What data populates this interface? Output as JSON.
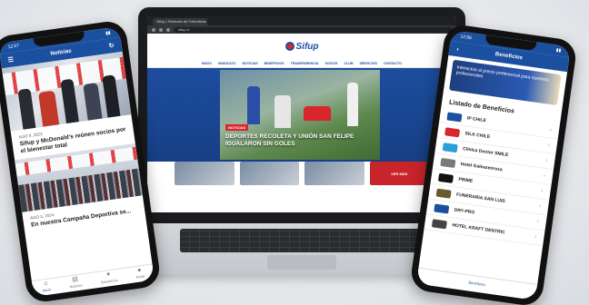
{
  "laptop": {
    "browser": {
      "tab_title": "Sifup | Sindicato de Futbolistas",
      "url": "sifup.cl"
    },
    "site": {
      "logo_text": "Sifup",
      "nav": [
        "INICIO",
        "SINDICATO",
        "NOTICIAS",
        "BENEFICIOS",
        "TRANSPARENCIA",
        "SOCIOS",
        "CLUB",
        "SERVICIOS",
        "CONTACTO"
      ],
      "hero": {
        "tag": "NOTICIAS",
        "title": "DEPORTES RECOLETA Y UNIÓN SAN FELIPE IGUALARON SIN GOLES"
      },
      "thumb_button": "VER MÁS"
    }
  },
  "phone_left": {
    "time": "12:57",
    "title": "Noticias",
    "news": [
      {
        "date": "AGO 9, 2024",
        "title": "Sifup y McDonald's reúnen socios por el bienestar total"
      },
      {
        "date": "AGO 3, 2024",
        "title": "En nuestra Campaña Deportiva se..."
      }
    ],
    "tabs": [
      {
        "label": "Inicio",
        "icon": "home-icon"
      },
      {
        "label": "Noticias",
        "icon": "news-icon"
      },
      {
        "label": "Beneficios",
        "icon": "gift-icon"
      },
      {
        "label": "Perfil",
        "icon": "user-icon"
      }
    ]
  },
  "phone_right": {
    "time": "12:56",
    "title": "Beneficios",
    "promo_text": "Interactúa al precio preferencial para nuestros profesionales",
    "section_title": "Listado de Beneficios",
    "benefits": [
      {
        "name": "IP CHILE",
        "color": "#1b4fa0"
      },
      {
        "name": "SILK CHILE",
        "color": "#d8262c"
      },
      {
        "name": "Clínica Doctor SMILE",
        "color": "#2a9fd6"
      },
      {
        "name": "Hotel Galeazenroza",
        "color": "#7a7a7a"
      },
      {
        "name": "PRIME",
        "color": "#111111"
      },
      {
        "name": "FUNERARIA SAN LUIS",
        "color": "#6b5a2e"
      },
      {
        "name": "DRY-PRO",
        "color": "#1b4fa0"
      },
      {
        "name": "HOTEL KRAFT DENTRIC",
        "color": "#444444"
      }
    ],
    "footer_label": "Beneficios"
  }
}
